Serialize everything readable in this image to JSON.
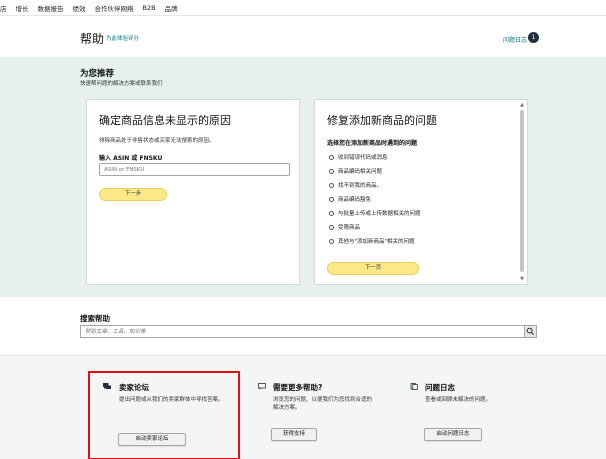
{
  "topnav": {
    "items": [
      "店",
      "增长",
      "数据报告",
      "绩效",
      "合作伙伴网络",
      "B2B",
      "品牌"
    ]
  },
  "header": {
    "title": "帮助",
    "subtitle_link": "为此体验评分",
    "issues_label": "问题日志",
    "issues_count": "1"
  },
  "recommended": {
    "title": "为您推荐",
    "subtitle": "快速帮问题的解决方案或联系我们",
    "card1": {
      "title": "确定商品信息未显示的原因",
      "description": "排除商品处于非售状态或买家无法搜索的原因。",
      "input_label": "输入 ASIN 或 FNSKU",
      "input_placeholder": "ASIN or FNSKU",
      "button": "下一步"
    },
    "card2": {
      "title": "修复添加新商品的问题",
      "question": "选择您在添加新商品时遇到的问题",
      "options": [
        "收到错误代码或消息",
        "商品编码相关问题",
        "找不到我的商品。",
        "商品编码豁免",
        "与批量上传或上传数据相关的问题",
        "受限商品",
        "其他与\"添加新商品\"相关的问题"
      ],
      "button": "下一页"
    }
  },
  "search": {
    "title": "搜索帮助",
    "placeholder": "帮助文章、工具、知识等"
  },
  "bottom": {
    "forum": {
      "title": "卖家论坛",
      "description": "提出问题或从我们的卖家群体中寻找答案。",
      "button": "启动卖家论坛"
    },
    "support": {
      "title": "需要更多帮助?",
      "description": "浏览您的问题、以便我们为您找到合适的解决方案。",
      "button": "获得支持"
    },
    "log": {
      "title": "问题日志",
      "description": "查看或回顾未解决的问题。",
      "button": "启动问题日志"
    }
  },
  "colors": {
    "accent_link": "#007185",
    "recommend_band": "#e6f0ef",
    "yellow_button": "#fde887",
    "highlight": "#e01010"
  }
}
